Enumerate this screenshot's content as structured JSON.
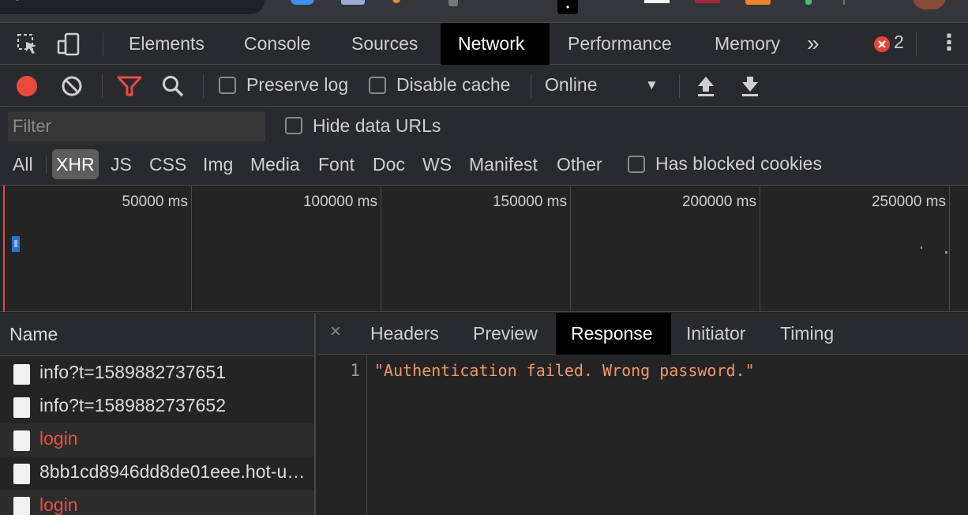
{
  "browser": {
    "omnibox_text": "/ g"
  },
  "devtools": {
    "tabs": [
      {
        "label": "Elements"
      },
      {
        "label": "Console"
      },
      {
        "label": "Sources"
      },
      {
        "label": "Network",
        "active": true
      },
      {
        "label": "Performance"
      },
      {
        "label": "Memory"
      }
    ],
    "overflow_glyph": "»",
    "error_count": "2",
    "menu_glyph": "⋮"
  },
  "toolbar": {
    "preserve_log": "Preserve log",
    "disable_cache": "Disable cache",
    "throttling": "Online"
  },
  "filters": {
    "placeholder": "Filter",
    "hide_data_urls": "Hide data URLs",
    "types": [
      "All",
      "XHR",
      "JS",
      "CSS",
      "Img",
      "Media",
      "Font",
      "Doc",
      "WS",
      "Manifest",
      "Other"
    ],
    "active_type": "XHR",
    "has_blocked_cookies": "Has blocked cookies"
  },
  "overview": {
    "ticks": [
      "50000 ms",
      "100000 ms",
      "150000 ms",
      "200000 ms",
      "250000 ms"
    ]
  },
  "requests": {
    "header": "Name",
    "rows": [
      {
        "name": "info?t=1589882737651",
        "error": false
      },
      {
        "name": "info?t=1589882737652",
        "error": false
      },
      {
        "name": "login",
        "error": true
      },
      {
        "name": "8bb1cd8946dd8de01eee.hot-update.json",
        "error": false
      },
      {
        "name": "login",
        "error": true
      }
    ]
  },
  "details": {
    "close_glyph": "×",
    "tabs": [
      "Headers",
      "Preview",
      "Response",
      "Initiator",
      "Timing"
    ],
    "active_tab": "Response",
    "line_number": "1",
    "response_body": "\"Authentication failed. Wrong password.\""
  },
  "colors": {
    "record_red": "#e84a3f",
    "error_text": "#ed4e42",
    "string_orange": "#f29766",
    "filter_red": "#ea4c3f"
  }
}
